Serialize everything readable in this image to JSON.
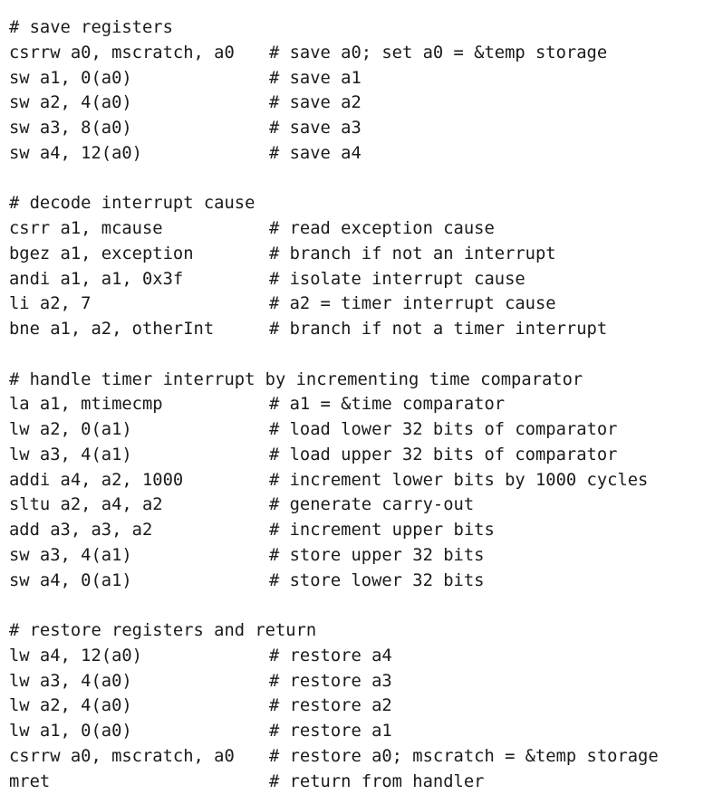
{
  "sections": [
    {
      "heading": "# save registers",
      "lines": [
        {
          "instr": "csrrw a0, mscratch, a0",
          "comment": "# save a0; set a0 = &temp storage"
        },
        {
          "instr": "sw a1, 0(a0)",
          "comment": "# save a1"
        },
        {
          "instr": "sw a2, 4(a0)",
          "comment": "# save a2"
        },
        {
          "instr": "sw a3, 8(a0)",
          "comment": "# save a3"
        },
        {
          "instr": "sw a4, 12(a0)",
          "comment": "# save a4"
        }
      ]
    },
    {
      "heading": "# decode interrupt cause",
      "lines": [
        {
          "instr": "csrr a1, mcause",
          "comment": "# read exception cause"
        },
        {
          "instr": "bgez a1, exception",
          "comment": "# branch if not an interrupt"
        },
        {
          "instr": "andi a1, a1, 0x3f",
          "comment": "# isolate interrupt cause"
        },
        {
          "instr": "li a2, 7",
          "comment": "# a2 = timer interrupt cause"
        },
        {
          "instr": "bne a1, a2, otherInt",
          "comment": "# branch if not a timer interrupt"
        }
      ]
    },
    {
      "heading": "# handle timer interrupt by incrementing time comparator",
      "lines": [
        {
          "instr": "la a1, mtimecmp",
          "comment": "# a1 = &time comparator"
        },
        {
          "instr": "lw a2, 0(a1)",
          "comment": "# load lower 32 bits of comparator"
        },
        {
          "instr": "lw a3, 4(a1)",
          "comment": "# load upper 32 bits of comparator"
        },
        {
          "instr": "addi a4, a2, 1000",
          "comment": "# increment lower bits by 1000 cycles"
        },
        {
          "instr": "sltu a2, a4, a2",
          "comment": "# generate carry-out"
        },
        {
          "instr": "add a3, a3, a2",
          "comment": "# increment upper bits"
        },
        {
          "instr": "sw a3, 4(a1)",
          "comment": "# store upper 32 bits"
        },
        {
          "instr": "sw a4, 0(a1)",
          "comment": "# store lower 32 bits"
        }
      ]
    },
    {
      "heading": "# restore registers and return",
      "lines": [
        {
          "instr": "lw a4, 12(a0)",
          "comment": "# restore a4"
        },
        {
          "instr": "lw a3, 4(a0)",
          "comment": "# restore a3"
        },
        {
          "instr": "lw a2, 4(a0)",
          "comment": "# restore a2"
        },
        {
          "instr": "lw a1, 0(a0)",
          "comment": "# restore a1"
        },
        {
          "instr": "csrrw a0, mscratch, a0",
          "comment": "# restore a0; mscratch = &temp storage"
        },
        {
          "instr": "mret",
          "comment": "# return from handler"
        }
      ]
    }
  ]
}
